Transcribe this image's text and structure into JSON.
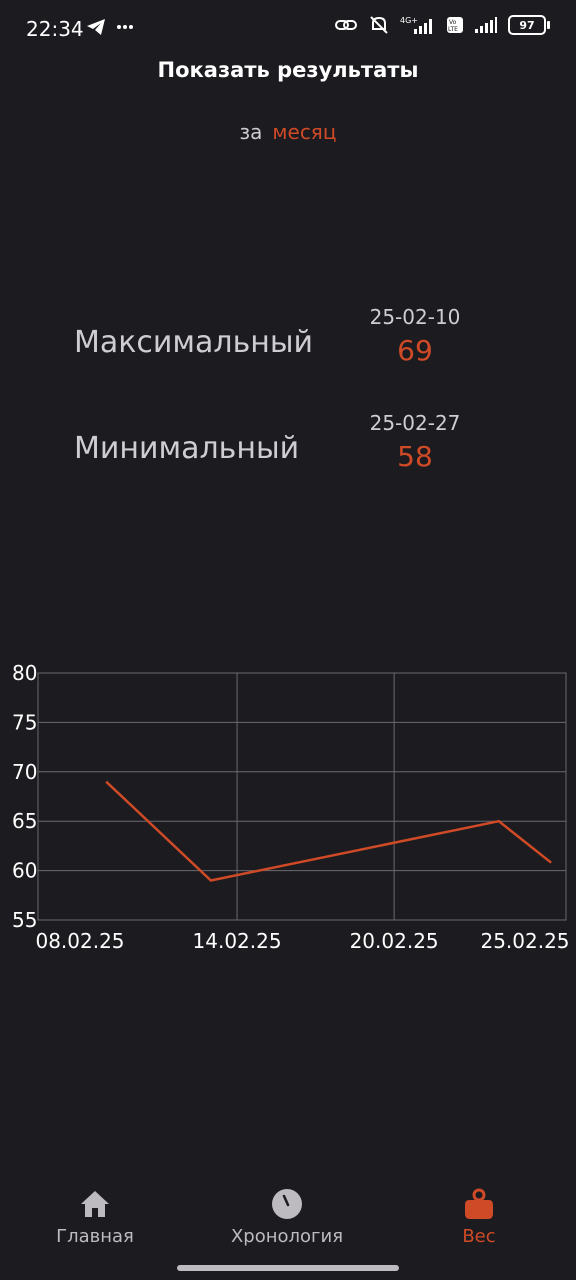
{
  "status": {
    "time": "22:34",
    "battery": "97",
    "network": "4G+"
  },
  "header": {
    "title": "Показать результаты"
  },
  "period": {
    "prefix": "за",
    "value": "месяц"
  },
  "stats": {
    "max": {
      "label": "Максимальный",
      "date": "25-02-10",
      "value": "69"
    },
    "min": {
      "label": "Минимальный",
      "date": "25-02-27",
      "value": "58"
    }
  },
  "chart_data": {
    "type": "line",
    "x": [
      "08.02.25",
      "14.02.25",
      "20.02.25",
      "25.02.25"
    ],
    "series": [
      {
        "values": [
          69,
          59,
          65,
          60.8
        ],
        "dates": [
          "09.02.25",
          "13.02.25",
          "24.02.25",
          "26.02.25"
        ]
      }
    ],
    "ylim": [
      55,
      80
    ],
    "yticks": [
      80,
      75,
      70,
      65,
      60,
      55
    ],
    "grid": true,
    "color": "#cf4a26"
  },
  "nav": {
    "items": [
      {
        "label": "Главная",
        "icon": "home-icon"
      },
      {
        "label": "Хронология",
        "icon": "clock-icon"
      },
      {
        "label": "Вес",
        "icon": "weight-icon"
      }
    ],
    "active_color": "#cf4a26"
  }
}
